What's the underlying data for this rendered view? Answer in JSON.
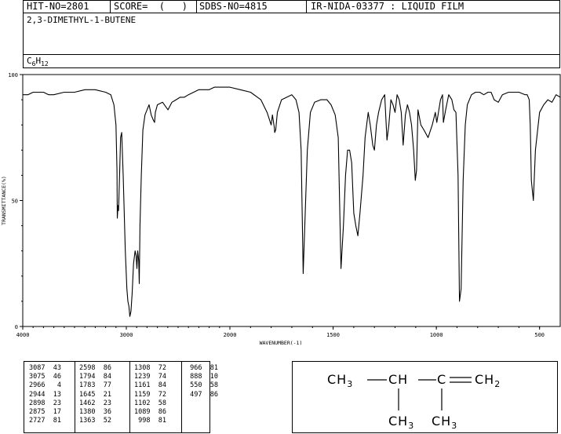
{
  "header": {
    "hit_no": "HIT-NO=2801",
    "score": "SCORE=  (   )",
    "sdbs_no": "SDBS-NO=4815",
    "source": "IR-NIDA-03377 : LIQUID FILM",
    "compound": "2,3-DIMETHYL-1-BUTENE",
    "formula_c": "C",
    "formula_c_n": "6",
    "formula_h": "H",
    "formula_h_n": "12"
  },
  "chart_data": {
    "type": "line",
    "title": "",
    "xlabel": "WAVENUMBER(-1)",
    "ylabel": "TRANSMITTANCE(%)",
    "xlim": [
      4000,
      400
    ],
    "ylim": [
      0,
      100
    ],
    "xticks": [
      "4000",
      "3000",
      "2000",
      "1500",
      "1000",
      "500"
    ],
    "yticks": [
      "100",
      "50",
      "0"
    ],
    "x": [
      4000,
      3950,
      3900,
      3850,
      3800,
      3750,
      3700,
      3600,
      3500,
      3400,
      3300,
      3200,
      3150,
      3120,
      3100,
      3090,
      3087,
      3080,
      3075,
      3065,
      3055,
      3045,
      3030,
      3010,
      2995,
      2985,
      2975,
      2966,
      2955,
      2944,
      2930,
      2915,
      2905,
      2898,
      2890,
      2880,
      2875,
      2868,
      2855,
      2840,
      2820,
      2800,
      2780,
      2760,
      2740,
      2727,
      2720,
      2700,
      2650,
      2598,
      2560,
      2520,
      2480,
      2440,
      2400,
      2350,
      2300,
      2250,
      2200,
      2150,
      2100,
      2050,
      2000,
      1950,
      1900,
      1850,
      1820,
      1800,
      1794,
      1785,
      1783,
      1778,
      1770,
      1750,
      1700,
      1680,
      1665,
      1655,
      1645,
      1635,
      1625,
      1610,
      1590,
      1560,
      1530,
      1510,
      1490,
      1475,
      1462,
      1450,
      1440,
      1430,
      1420,
      1410,
      1400,
      1390,
      1380,
      1370,
      1363,
      1355,
      1345,
      1330,
      1320,
      1308,
      1300,
      1290,
      1280,
      1265,
      1250,
      1239,
      1230,
      1220,
      1210,
      1200,
      1190,
      1180,
      1170,
      1161,
      1150,
      1140,
      1130,
      1120,
      1110,
      1102,
      1096,
      1089,
      1075,
      1060,
      1040,
      1020,
      1005,
      998,
      990,
      980,
      970,
      966,
      955,
      940,
      925,
      915,
      905,
      895,
      888,
      880,
      870,
      860,
      850,
      830,
      810,
      790,
      770,
      750,
      735,
      720,
      700,
      680,
      650,
      600,
      570,
      560,
      550,
      545,
      540,
      530,
      520,
      500,
      480,
      460,
      440,
      420,
      400
    ],
    "y": [
      92,
      92,
      93,
      93,
      93,
      92,
      92,
      93,
      93,
      94,
      94,
      93,
      92,
      88,
      80,
      62,
      43,
      48,
      46,
      60,
      75,
      77,
      60,
      30,
      15,
      10,
      8,
      4,
      6,
      13,
      25,
      30,
      28,
      23,
      30,
      26,
      17,
      40,
      60,
      78,
      84,
      86,
      88,
      84,
      82,
      81,
      85,
      88,
      89,
      86,
      89,
      90,
      91,
      91,
      92,
      93,
      94,
      94,
      94,
      95,
      95,
      95,
      95,
      94,
      93,
      90,
      85,
      80,
      84,
      79,
      77,
      78,
      85,
      90,
      92,
      90,
      85,
      70,
      21,
      45,
      70,
      85,
      89,
      90,
      90,
      88,
      84,
      75,
      23,
      40,
      60,
      70,
      70,
      65,
      45,
      40,
      36,
      45,
      52,
      60,
      75,
      85,
      80,
      72,
      70,
      80,
      85,
      90,
      92,
      74,
      80,
      90,
      88,
      85,
      92,
      90,
      85,
      72,
      84,
      88,
      85,
      80,
      70,
      58,
      62,
      86,
      80,
      78,
      75,
      80,
      85,
      81,
      85,
      90,
      92,
      81,
      86,
      92,
      90,
      86,
      85,
      60,
      10,
      15,
      58,
      80,
      88,
      92,
      93,
      93,
      92,
      93,
      93,
      90,
      89,
      92,
      93,
      93,
      92,
      92,
      90,
      80,
      58,
      50,
      70,
      85,
      88,
      90,
      89,
      92,
      91,
      90,
      88
    ]
  },
  "peak_table": [
    [
      [
        "3087",
        "43"
      ],
      [
        "3075",
        "46"
      ],
      [
        "2966",
        "4"
      ],
      [
        "2944",
        "13"
      ],
      [
        "2898",
        "23"
      ],
      [
        "2875",
        "17"
      ],
      [
        "2727",
        "81"
      ]
    ],
    [
      [
        "2598",
        "86"
      ],
      [
        "1794",
        "84"
      ],
      [
        "1783",
        "77"
      ],
      [
        "1645",
        "21"
      ],
      [
        "1462",
        "23"
      ],
      [
        "1380",
        "36"
      ],
      [
        "1363",
        "52"
      ]
    ],
    [
      [
        "1308",
        "72"
      ],
      [
        "1239",
        "74"
      ],
      [
        "1161",
        "84"
      ],
      [
        "1159",
        "72"
      ],
      [
        "1102",
        "58"
      ],
      [
        "1089",
        "86"
      ],
      [
        "998",
        "81"
      ]
    ],
    [
      [
        "966",
        "81"
      ],
      [
        "888",
        "10"
      ],
      [
        "550",
        "58"
      ],
      [
        "497",
        "86"
      ]
    ]
  ],
  "structure": {
    "ch3_left": "CH3 — CH — C ═ CH2",
    "ch3_a": "CH3",
    "ch": "CH",
    "c": "C",
    "ch2": "CH2",
    "ch3_b": "CH3",
    "ch3_c": "CH3"
  }
}
